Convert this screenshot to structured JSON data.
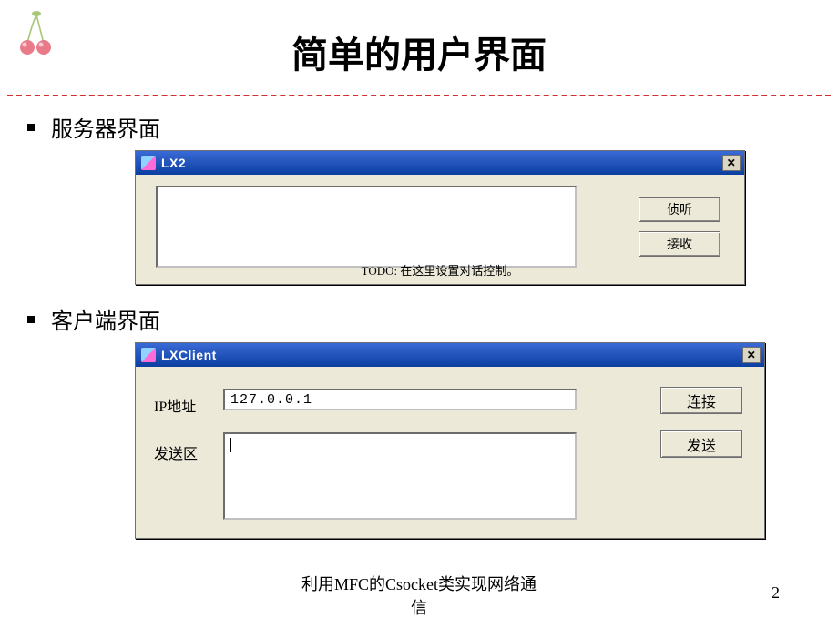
{
  "slide": {
    "title": "简单的用户界面",
    "footer_line1": "利用MFC的Csocket类实现网络通",
    "footer_line2": "信",
    "page_number": "2"
  },
  "bullets": {
    "server_label": "服务器界面",
    "client_label": "客户端界面"
  },
  "server_window": {
    "title": "LX2",
    "textarea_value": "",
    "todo_text": "TODO: 在这里设置对话控制。",
    "listen_btn": "侦听",
    "receive_btn": "接收"
  },
  "client_window": {
    "title": "LXClient",
    "ip_label": "IP地址",
    "ip_value": "127.0.0.1",
    "send_label": "发送区",
    "send_value": "",
    "connect_btn": "连接",
    "send_btn": "发送"
  }
}
